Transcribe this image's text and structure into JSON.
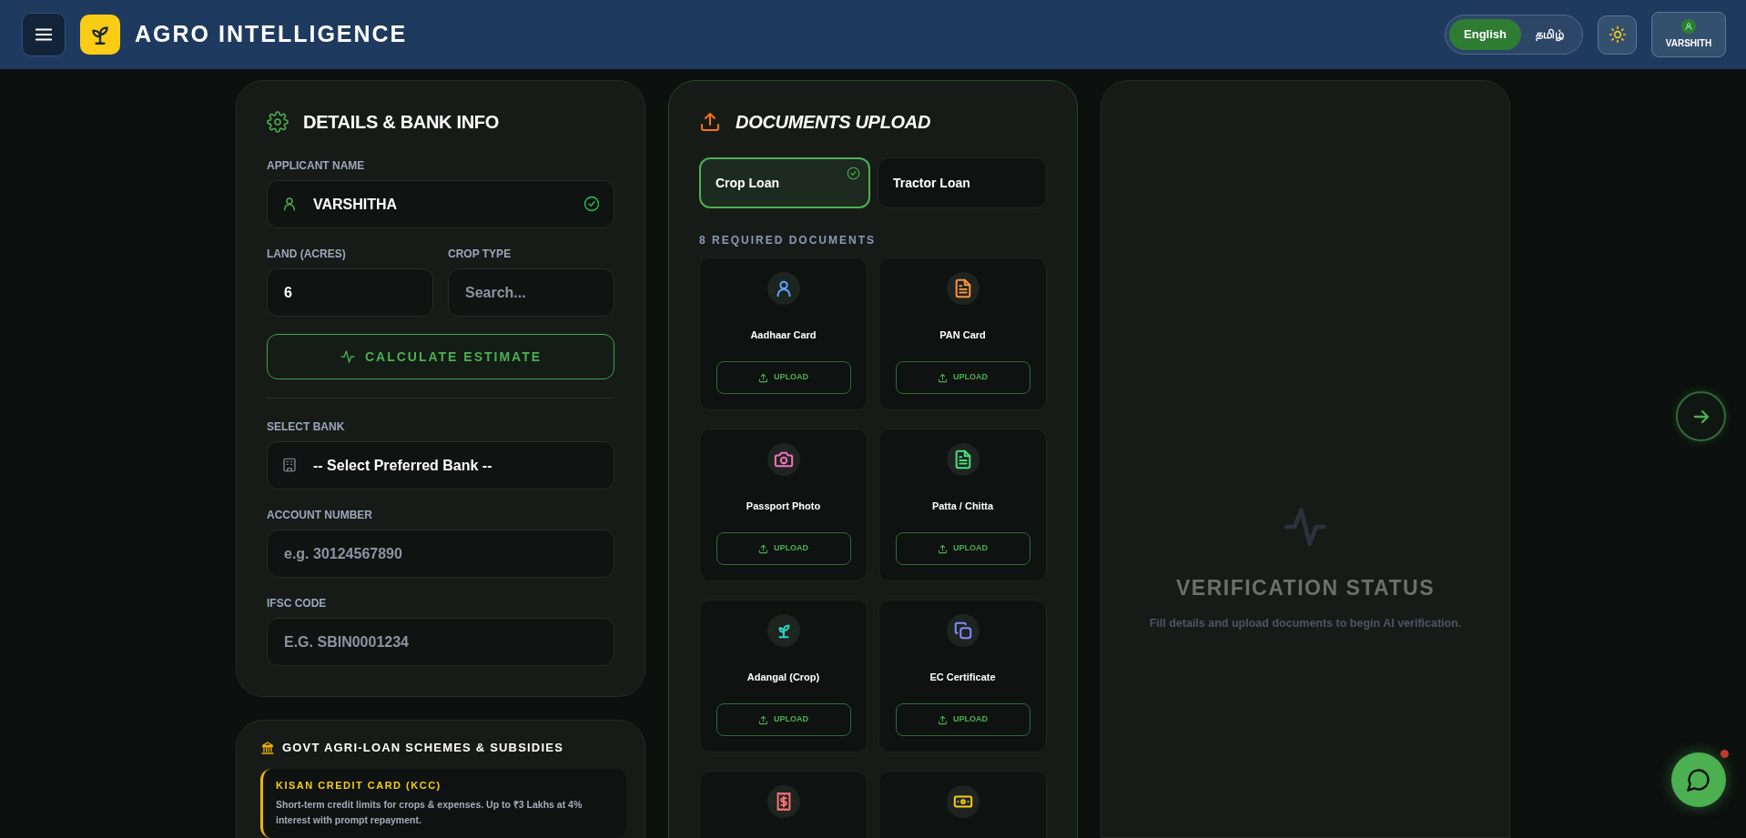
{
  "header": {
    "title": "AGRO INTELLIGENCE",
    "languages": [
      {
        "label": "English",
        "selected": true
      },
      {
        "label": "தமிழ்",
        "selected": false
      }
    ],
    "user": {
      "name": "VARSHITH"
    }
  },
  "details": {
    "title": "DETAILS & BANK INFO",
    "applicant": {
      "label": "APPLICANT NAME",
      "value": "VARSHITHA",
      "verified": true
    },
    "land": {
      "label": "LAND (ACRES)",
      "value": "6"
    },
    "crop": {
      "label": "CROP TYPE",
      "placeholder": "Search..."
    },
    "calculate_button": "CALCULATE ESTIMATE",
    "bank": {
      "label": "SELECT BANK",
      "value": "-- Select Preferred Bank --"
    },
    "account": {
      "label": "ACCOUNT NUMBER",
      "placeholder": "e.g. 30124567890"
    },
    "ifsc": {
      "label": "IFSC CODE",
      "placeholder": "E.G. SBIN0001234"
    }
  },
  "schemes": {
    "title": "GOVT AGRI-LOAN SCHEMES & SUBSIDIES",
    "items": [
      {
        "title": "KISAN CREDIT CARD (KCC)",
        "description": "Short-term credit limits for crops & expenses. Up to ₹3 Lakhs at 4% interest with prompt repayment."
      }
    ]
  },
  "documents": {
    "title": "DOCUMENTS UPLOAD",
    "loan_types": [
      {
        "label": "Crop Loan",
        "selected": true
      },
      {
        "label": "Tractor Loan",
        "selected": false
      }
    ],
    "required_label": "8 REQUIRED DOCUMENTS",
    "items": [
      {
        "kind": "person",
        "color": "#60a5fa",
        "name": "Aadhaar Card",
        "upload_label": "UPLOAD"
      },
      {
        "kind": "file",
        "color": "#fb923c",
        "name": "PAN Card",
        "upload_label": "UPLOAD"
      },
      {
        "kind": "camera",
        "color": "#f472b6",
        "name": "Passport Photo",
        "upload_label": "UPLOAD"
      },
      {
        "kind": "file",
        "color": "#4ade80",
        "name": "Patta / Chitta",
        "upload_label": "UPLOAD"
      },
      {
        "kind": "sprout",
        "color": "#2dd4bf",
        "name": "Adangal (Crop)",
        "upload_label": "UPLOAD"
      },
      {
        "kind": "copy",
        "color": "#818cf8",
        "name": "EC Certificate",
        "upload_label": "UPLOAD"
      },
      {
        "kind": "receipt",
        "color": "#f87171"
      },
      {
        "kind": "money",
        "color": "#facc15"
      }
    ]
  },
  "verification": {
    "title": "VERIFICATION STATUS",
    "message": "Fill details and upload documents to begin AI verification."
  }
}
